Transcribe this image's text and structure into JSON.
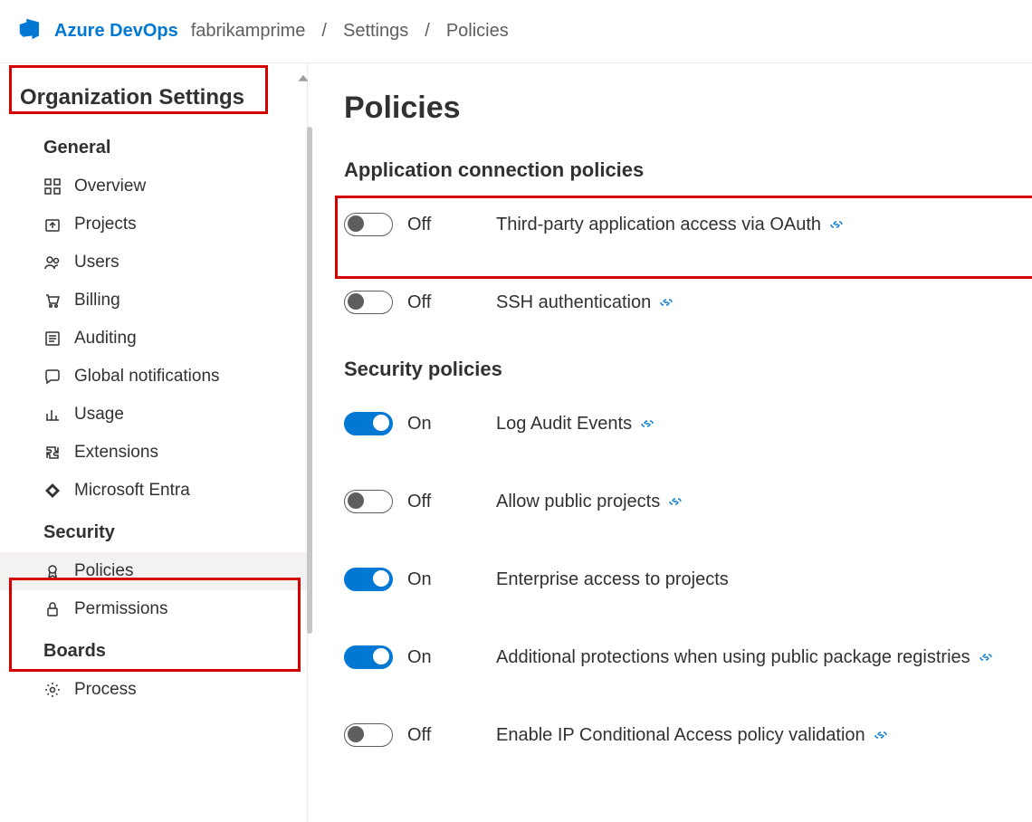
{
  "header": {
    "brand": "Azure DevOps",
    "breadcrumb": [
      "fabrikamprime",
      "Settings",
      "Policies"
    ]
  },
  "sidebar": {
    "title": "Organization Settings",
    "sections": [
      {
        "name": "General",
        "items": [
          {
            "id": "overview",
            "label": "Overview",
            "icon": "grid-icon"
          },
          {
            "id": "projects",
            "label": "Projects",
            "icon": "upload-icon"
          },
          {
            "id": "users",
            "label": "Users",
            "icon": "users-icon"
          },
          {
            "id": "billing",
            "label": "Billing",
            "icon": "cart-icon"
          },
          {
            "id": "auditing",
            "label": "Auditing",
            "icon": "list-icon"
          },
          {
            "id": "global-notifications",
            "label": "Global notifications",
            "icon": "chat-icon"
          },
          {
            "id": "usage",
            "label": "Usage",
            "icon": "bar-chart-icon"
          },
          {
            "id": "extensions",
            "label": "Extensions",
            "icon": "puzzle-icon"
          },
          {
            "id": "microsoft-entra",
            "label": "Microsoft Entra",
            "icon": "diamond-icon"
          }
        ]
      },
      {
        "name": "Security",
        "items": [
          {
            "id": "policies",
            "label": "Policies",
            "icon": "badge-icon",
            "active": true
          },
          {
            "id": "permissions",
            "label": "Permissions",
            "icon": "lock-icon"
          }
        ]
      },
      {
        "name": "Boards",
        "items": [
          {
            "id": "process",
            "label": "Process",
            "icon": "gear-icon"
          }
        ]
      }
    ]
  },
  "main": {
    "title": "Policies",
    "groups": [
      {
        "title": "Application connection policies",
        "policies": [
          {
            "id": "oauth",
            "label": "Third-party application access via OAuth",
            "state": "Off",
            "on": false,
            "has_link": true,
            "highlight": true
          },
          {
            "id": "ssh",
            "label": "SSH authentication",
            "state": "Off",
            "on": false,
            "has_link": true
          }
        ]
      },
      {
        "title": "Security policies",
        "policies": [
          {
            "id": "audit",
            "label": "Log Audit Events",
            "state": "On",
            "on": true,
            "has_link": true
          },
          {
            "id": "public-projects",
            "label": "Allow public projects",
            "state": "Off",
            "on": false,
            "has_link": true
          },
          {
            "id": "enterprise-access",
            "label": "Enterprise access to projects",
            "state": "On",
            "on": true,
            "has_link": false
          },
          {
            "id": "package-registries",
            "label": "Additional protections when using public package registries",
            "state": "On",
            "on": true,
            "has_link": true
          },
          {
            "id": "ip-conditional",
            "label": "Enable IP Conditional Access policy validation",
            "state": "Off",
            "on": false,
            "has_link": true
          }
        ]
      }
    ]
  }
}
